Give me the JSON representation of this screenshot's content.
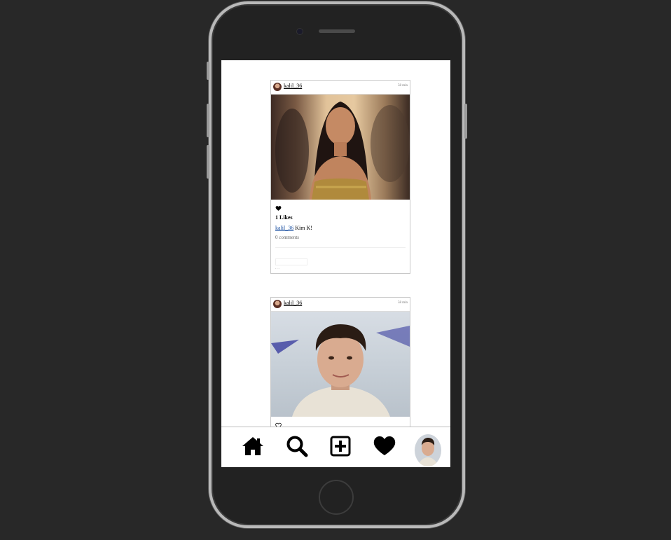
{
  "posts": [
    {
      "username": "kalil_36",
      "timestamp": "58 min",
      "likes": "1 Likes",
      "caption_user": "kalil_36",
      "caption_text": " Kim K!",
      "comments": "0 comments",
      "comment_placeholder": "",
      "more": "..."
    },
    {
      "username": "kalil_36",
      "timestamp": "58 min"
    }
  ],
  "nav": {
    "items": [
      "home-icon",
      "search-icon",
      "add-post-icon",
      "heart-icon",
      "profile-avatar"
    ]
  },
  "colors": {
    "background": "#282828",
    "screen": "#ffffff",
    "link": "#1a4fa0"
  }
}
